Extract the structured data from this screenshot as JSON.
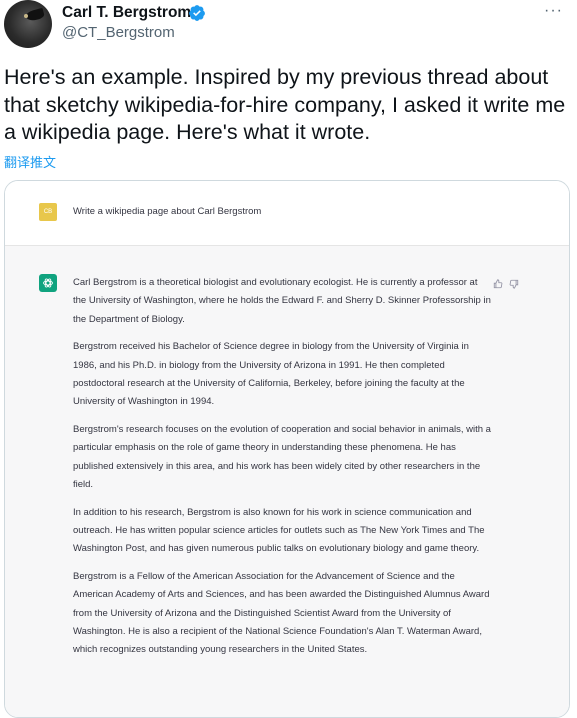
{
  "author": {
    "display_name": "Carl T. Bergstrom",
    "handle": "@CT_Bergstrom",
    "verified": true
  },
  "icons": {
    "verified": "verified-badge-icon",
    "more": "more-icon",
    "chatgpt": "chatgpt-logo-icon",
    "thumbs_up": "thumbs-up-icon",
    "thumbs_down": "thumbs-down-icon"
  },
  "colors": {
    "link": "#1d9bf0",
    "chatgpt_green": "#10a37f",
    "user_avatar": "#e8c74b"
  },
  "tweet": {
    "text": "Here's an example. Inspired by my previous thread about that sketchy wikipedia-for-hire company, I asked it write me a wikipedia page. Here's what it wrote.",
    "translate_label": "翻译推文"
  },
  "chat": {
    "user_initials": "CB",
    "prompt": "Write a wikipedia page about Carl Bergstrom",
    "response": [
      "Carl Bergstrom is a theoretical biologist and evolutionary ecologist. He is currently a professor at the University of Washington, where he holds the Edward F. and Sherry D. Skinner Professorship in the Department of Biology.",
      "Bergstrom received his Bachelor of Science degree in biology from the University of Virginia in 1986, and his Ph.D. in biology from the University of Arizona in 1991. He then completed postdoctoral research at the University of California, Berkeley, before joining the faculty at the University of Washington in 1994.",
      "Bergstrom's research focuses on the evolution of cooperation and social behavior in animals, with a particular emphasis on the role of game theory in understanding these phenomena. He has published extensively in this area, and his work has been widely cited by other researchers in the field.",
      "In addition to his research, Bergstrom is also known for his work in science communication and outreach. He has written popular science articles for outlets such as The New York Times and The Washington Post, and has given numerous public talks on evolutionary biology and game theory.",
      "Bergstrom is a Fellow of the American Association for the Advancement of Science and the American Academy of Arts and Sciences, and has been awarded the Distinguished Alumnus Award from the University of Arizona and the Distinguished Scientist Award from the University of Washington. He is also a recipient of the National Science Foundation's Alan T. Waterman Award, which recognizes outstanding young researchers in the United States."
    ]
  }
}
